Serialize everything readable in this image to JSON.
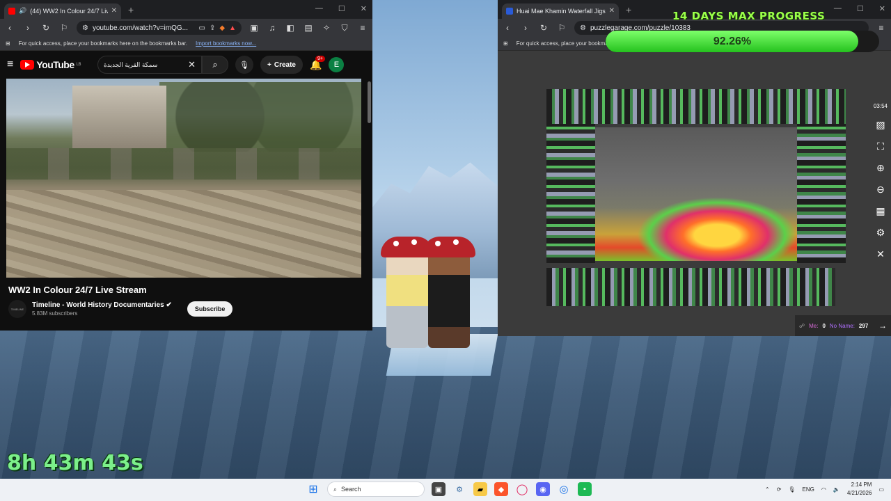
{
  "overlay": {
    "heading": "14 DAYS MAX PROGRESS",
    "progress_label": "92.26%",
    "progress_fraction": 0.9226,
    "timer": "8h 43m 43s"
  },
  "left_browser": {
    "tab_title": "(44) WW2 In Colour 24/7 Live",
    "url": "youtube.com/watch?v=imQG...",
    "bookmarks_hint": "For quick access, place your bookmarks here on the bookmarks bar.",
    "bookmarks_link": "Import bookmarks now...",
    "youtube": {
      "logo_text": "YouTube",
      "logo_country": "LB",
      "search_value": "سمكة القرية الجديدة",
      "create_label": "Create",
      "notifications_badge": "9+",
      "avatar_letter": "E",
      "video_title": "WW2 In Colour 24/7 Live Stream",
      "channel_name": "Timeline - World History Documentaries",
      "subscribers": "5.83M subscribers",
      "subscribe_label": "Subscribe",
      "channel_avatar_text": "TIMELINE"
    }
  },
  "right_browser": {
    "tab_title": "Huai Mae Khamin Waterfall Jigs",
    "url": "puzzlegarage.com/puzzle/10383",
    "bookmarks_hint": "For quick access, place your bookmarks",
    "puzzle": {
      "time": "03:54",
      "me_label": "Me:",
      "me_count": "0",
      "noname_label": "No Name:",
      "noname_count": "297"
    }
  },
  "taskbar": {
    "search_placeholder": "Search",
    "language": "ENG",
    "time": "2:14 PM",
    "date": "4/21/2026"
  }
}
